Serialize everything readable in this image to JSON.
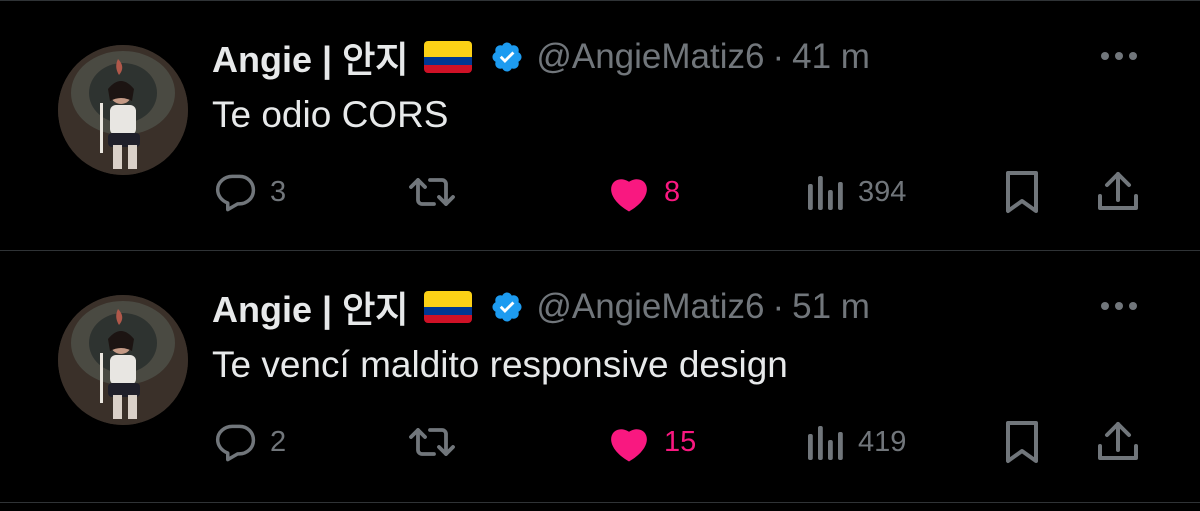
{
  "tweets": [
    {
      "name": "Angie | 안지",
      "handle": "@AngieMatiz6",
      "separator": "·",
      "time": "41 m",
      "text": "Te odio CORS",
      "replies": "3",
      "likes": "8",
      "views": "394"
    },
    {
      "name": "Angie | 안지",
      "handle": "@AngieMatiz6",
      "separator": "·",
      "time": "51 m",
      "text": "Te vencí maldito responsive design",
      "replies": "2",
      "likes": "15",
      "views": "419"
    }
  ],
  "icons": {
    "avatar": "avatar",
    "flag": "colombia-flag-icon",
    "verified": "verified-badge-icon",
    "more": "more-icon",
    "reply": "reply-icon",
    "retweet": "retweet-icon",
    "like": "heart-icon",
    "views": "views-icon",
    "bookmark": "bookmark-icon",
    "share": "share-icon"
  },
  "colors": {
    "background": "#000000",
    "text": "#e7e9ea",
    "muted": "#71767b",
    "like": "#f91880",
    "verified": "#1d9bf0",
    "divider": "#2f3336"
  }
}
